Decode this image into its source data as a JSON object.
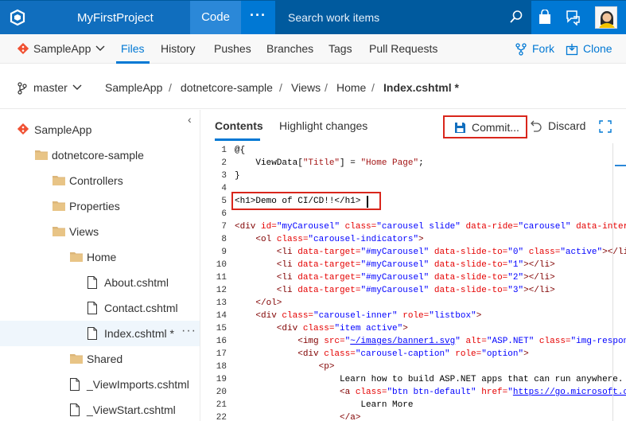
{
  "topbar": {
    "project_name": "MyFirstProject",
    "active_hub": "Code",
    "more_label": "···",
    "search_placeholder": "Search work items"
  },
  "repobar": {
    "repo_name": "SampleApp",
    "tabs": [
      {
        "label": "Files",
        "active": true
      },
      {
        "label": "History",
        "active": false
      },
      {
        "label": "Pushes",
        "active": false
      },
      {
        "label": "Branches",
        "active": false
      },
      {
        "label": "Tags",
        "active": false
      },
      {
        "label": "Pull Requests",
        "active": false
      }
    ],
    "fork_label": "Fork",
    "clone_label": "Clone"
  },
  "breadcrumb": {
    "branch": "master",
    "path": [
      "SampleApp",
      "dotnetcore-sample",
      "Views",
      "Home",
      "Index.cshtml *"
    ]
  },
  "tree": {
    "items": [
      {
        "label": "SampleApp",
        "icon": "repo-icon"
      },
      {
        "label": "dotnetcore-sample",
        "icon": "folder-icon"
      },
      {
        "label": "Controllers",
        "icon": "folder-icon"
      },
      {
        "label": "Properties",
        "icon": "folder-icon"
      },
      {
        "label": "Views",
        "icon": "folder-icon"
      },
      {
        "label": "Home",
        "icon": "folder-icon"
      },
      {
        "label": "About.cshtml",
        "icon": "file-icon"
      },
      {
        "label": "Contact.cshtml",
        "icon": "file-icon"
      },
      {
        "label": "Index.cshtml *",
        "icon": "file-icon",
        "selected": true
      },
      {
        "label": "Shared",
        "icon": "folder-icon"
      },
      {
        "label": "_ViewImports.cshtml",
        "icon": "file-icon"
      },
      {
        "label": "_ViewStart.cshtml",
        "icon": "file-icon"
      }
    ],
    "item_more": "···"
  },
  "editor": {
    "tabs": [
      {
        "label": "Contents",
        "active": true
      },
      {
        "label": "Highlight changes",
        "active": false
      }
    ],
    "commit_label": "Commit...",
    "discard_label": "Discard",
    "lines": [
      {
        "n": "1",
        "segs": [
          [
            "c-razor",
            "@{"
          ]
        ]
      },
      {
        "n": "2",
        "segs": [
          [
            "c-razor",
            "    ViewData["
          ],
          [
            "c-str",
            "\"Title\""
          ],
          [
            "c-razor",
            "] = "
          ],
          [
            "c-str",
            "\"Home Page\""
          ],
          [
            "c-razor",
            ";"
          ]
        ]
      },
      {
        "n": "3",
        "segs": [
          [
            "c-razor",
            "}"
          ]
        ]
      },
      {
        "n": "4",
        "segs": []
      },
      {
        "n": "5",
        "segs": [
          [
            "c-razor",
            "<h1>Demo of CI/CD!!</h1>"
          ]
        ]
      },
      {
        "n": "6",
        "segs": []
      },
      {
        "n": "7",
        "segs": [
          [
            "c-tag",
            "<div "
          ],
          [
            "c-attr",
            "id="
          ],
          [
            "c-val",
            "\"myCarousel\""
          ],
          [
            "c-attr",
            " class="
          ],
          [
            "c-val",
            "\"carousel slide\""
          ],
          [
            "c-attr",
            " data-ride="
          ],
          [
            "c-val",
            "\"carousel\""
          ],
          [
            "c-attr",
            " data-inter"
          ]
        ]
      },
      {
        "n": "8",
        "segs": [
          [
            "c-tag",
            "    <ol "
          ],
          [
            "c-attr",
            "class="
          ],
          [
            "c-val",
            "\"carousel-indicators\""
          ],
          [
            "c-tag",
            ">"
          ]
        ]
      },
      {
        "n": "9",
        "segs": [
          [
            "c-tag",
            "        <li "
          ],
          [
            "c-attr",
            "data-target="
          ],
          [
            "c-val",
            "\"#myCarousel\""
          ],
          [
            "c-attr",
            " data-slide-to="
          ],
          [
            "c-val",
            "\"0\""
          ],
          [
            "c-attr",
            " class="
          ],
          [
            "c-val",
            "\"active\""
          ],
          [
            "c-tag",
            "></li"
          ]
        ]
      },
      {
        "n": "10",
        "segs": [
          [
            "c-tag",
            "        <li "
          ],
          [
            "c-attr",
            "data-target="
          ],
          [
            "c-val",
            "\"#myCarousel\""
          ],
          [
            "c-attr",
            " data-slide-to="
          ],
          [
            "c-val",
            "\"1\""
          ],
          [
            "c-tag",
            "></li>"
          ]
        ]
      },
      {
        "n": "11",
        "segs": [
          [
            "c-tag",
            "        <li "
          ],
          [
            "c-attr",
            "data-target="
          ],
          [
            "c-val",
            "\"#myCarousel\""
          ],
          [
            "c-attr",
            " data-slide-to="
          ],
          [
            "c-val",
            "\"2\""
          ],
          [
            "c-tag",
            "></li>"
          ]
        ]
      },
      {
        "n": "12",
        "segs": [
          [
            "c-tag",
            "        <li "
          ],
          [
            "c-attr",
            "data-target="
          ],
          [
            "c-val",
            "\"#myCarousel\""
          ],
          [
            "c-attr",
            " data-slide-to="
          ],
          [
            "c-val",
            "\"3\""
          ],
          [
            "c-tag",
            "></li>"
          ]
        ]
      },
      {
        "n": "13",
        "segs": [
          [
            "c-tag",
            "    </ol>"
          ]
        ]
      },
      {
        "n": "14",
        "segs": [
          [
            "c-tag",
            "    <div "
          ],
          [
            "c-attr",
            "class="
          ],
          [
            "c-val",
            "\"carousel-inner\""
          ],
          [
            "c-attr",
            " role="
          ],
          [
            "c-val",
            "\"listbox\""
          ],
          [
            "c-tag",
            ">"
          ]
        ]
      },
      {
        "n": "15",
        "segs": [
          [
            "c-tag",
            "        <div "
          ],
          [
            "c-attr",
            "class="
          ],
          [
            "c-val",
            "\"item active\""
          ],
          [
            "c-tag",
            ">"
          ]
        ]
      },
      {
        "n": "16",
        "segs": [
          [
            "c-tag",
            "            <img "
          ],
          [
            "c-attr",
            "src="
          ],
          [
            "c-val",
            "\""
          ],
          [
            "c-link",
            "~/images/banner1.svg"
          ],
          [
            "c-val",
            "\""
          ],
          [
            "c-attr",
            " alt="
          ],
          [
            "c-val",
            "\"ASP.NET\""
          ],
          [
            "c-attr",
            " class="
          ],
          [
            "c-val",
            "\"img-respon"
          ]
        ]
      },
      {
        "n": "17",
        "segs": [
          [
            "c-tag",
            "            <div "
          ],
          [
            "c-attr",
            "class="
          ],
          [
            "c-val",
            "\"carousel-caption\""
          ],
          [
            "c-attr",
            " role="
          ],
          [
            "c-val",
            "\"option\""
          ],
          [
            "c-tag",
            ">"
          ]
        ]
      },
      {
        "n": "18",
        "segs": [
          [
            "c-tag",
            "                <p>"
          ]
        ]
      },
      {
        "n": "19",
        "segs": [
          [
            "c-razor",
            "                    Learn how to build ASP.NET apps that can run anywhere."
          ]
        ]
      },
      {
        "n": "20",
        "segs": [
          [
            "c-tag",
            "                    <a "
          ],
          [
            "c-attr",
            "class="
          ],
          [
            "c-val",
            "\"btn btn-default\""
          ],
          [
            "c-attr",
            " href="
          ],
          [
            "c-val",
            "\""
          ],
          [
            "c-link",
            "https://go.microsoft.c"
          ]
        ]
      },
      {
        "n": "21",
        "segs": [
          [
            "c-razor",
            "                        Learn More"
          ]
        ]
      },
      {
        "n": "22",
        "segs": [
          [
            "c-tag",
            "                    </a>"
          ]
        ]
      }
    ]
  },
  "colors": {
    "topbar": "#0078d4",
    "accent": "#0078d4",
    "highlight_border": "#d9261c",
    "git_orange": "#f05133"
  }
}
